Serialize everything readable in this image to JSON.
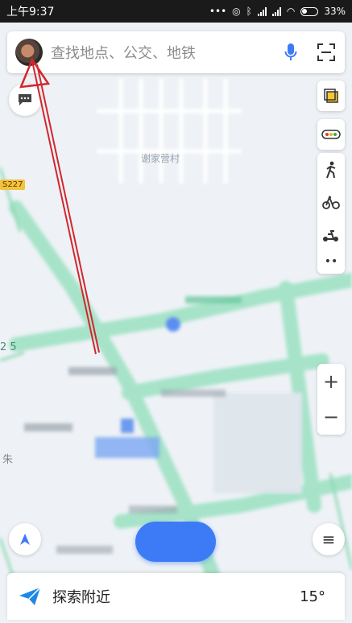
{
  "status_bar": {
    "time": "上午9:37",
    "battery": "33%"
  },
  "search": {
    "placeholder": "查找地点、公交、地铁"
  },
  "map": {
    "road_badge": "S227",
    "village_label": "谢家营村",
    "road_label_left": "2 5",
    "label_zhu": "朱"
  },
  "bottom": {
    "explore_label": "探索附近",
    "temperature": "15°"
  },
  "icons": {
    "search_bar": [
      "avatar",
      "mic-icon",
      "scan-icon"
    ],
    "right_column": [
      "layers-icon",
      "traffic-icon",
      "walk-icon",
      "bike-icon",
      "scooter-icon",
      "more-icon"
    ],
    "zoom": [
      "zoom-in-icon",
      "zoom-out-icon"
    ]
  },
  "colors": {
    "accent": "#3d7bf6",
    "road_green": "#8fd9b6",
    "annotation_arrow": "#d3262d"
  }
}
